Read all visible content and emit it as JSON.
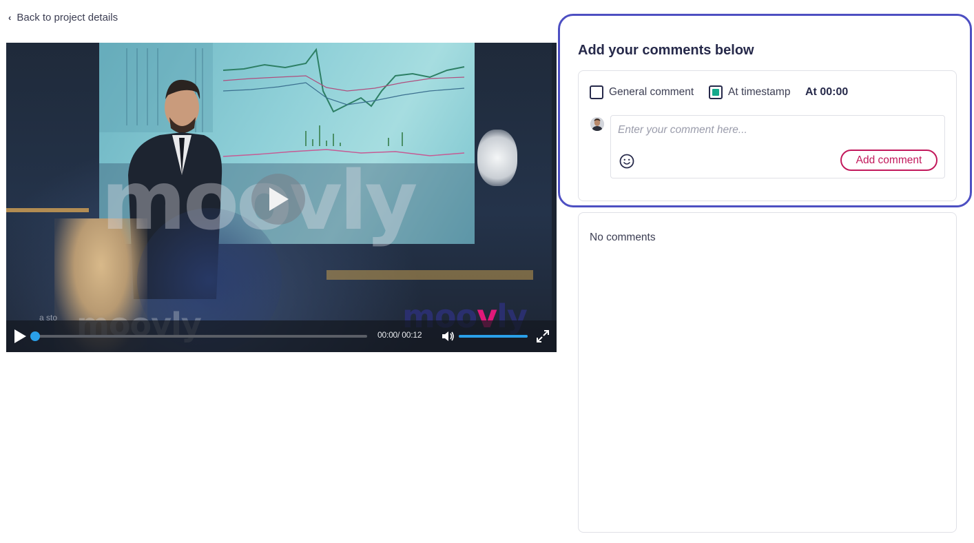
{
  "nav": {
    "back_label": "Back to project details",
    "back_icon": "chevron-left-icon"
  },
  "video": {
    "watermark_text": "moovly",
    "brand_logo_left": "moo",
    "brand_logo_mid": "v",
    "brand_logo_right": "ly",
    "tagline_text": "a sto",
    "time_display": "00:00/ 00:12",
    "progress": 0,
    "volume": 1.0,
    "accent_color": "#2a9fe8"
  },
  "comments": {
    "title": "Add your comments below",
    "general_label": "General comment",
    "general_checked": false,
    "timestamp_label": "At timestamp",
    "timestamp_checked": true,
    "timestamp_value": "At 00:00",
    "input_placeholder": "Enter your comment here...",
    "input_value": "",
    "add_button_label": "Add comment",
    "empty_text": "No comments",
    "frame_color": "#4d4fc2",
    "button_color": "#c2185b",
    "checkbox_color": "#14a98b"
  }
}
